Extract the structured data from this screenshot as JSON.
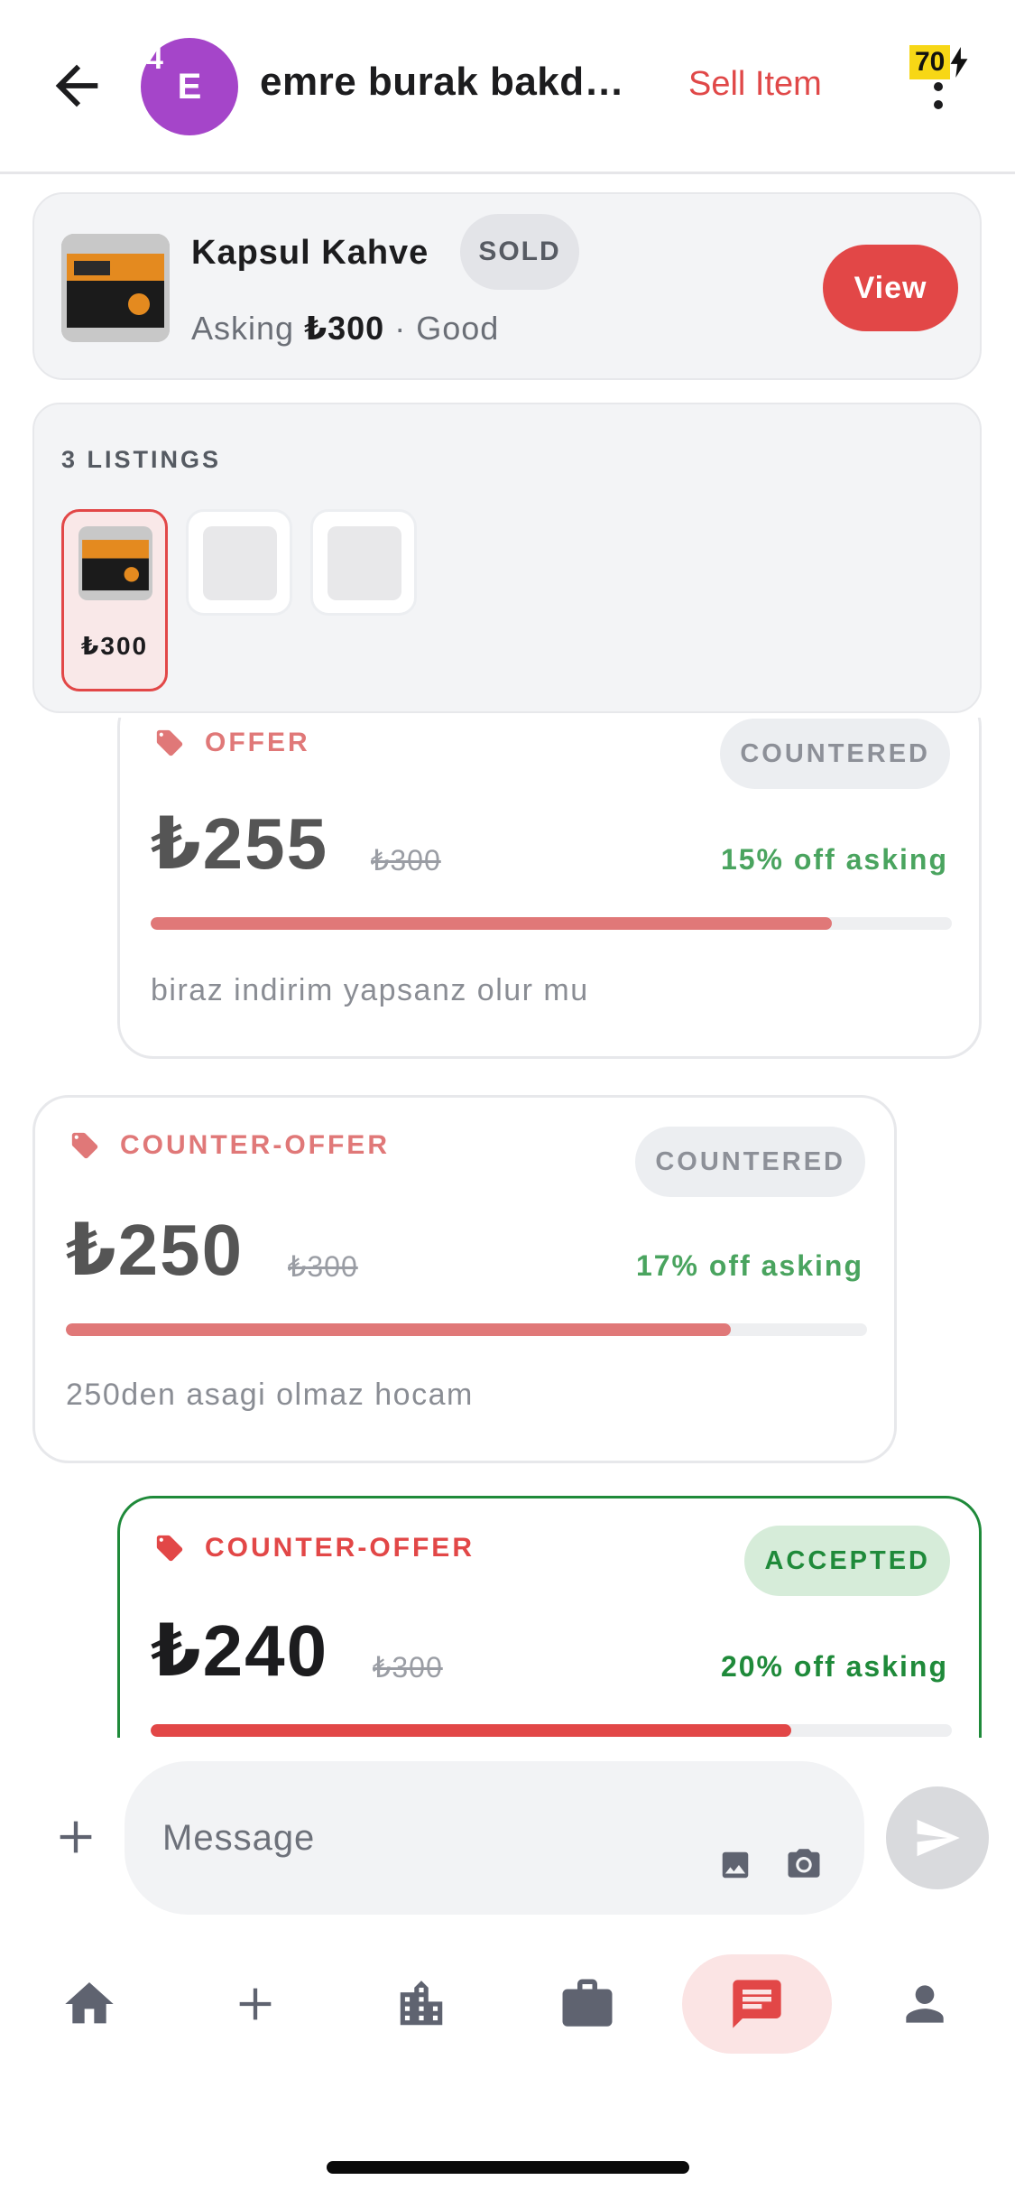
{
  "header": {
    "back_icon": "arrow-left-icon",
    "avatar_initial": "E",
    "avatar_badge": "4",
    "avatar_color": "#a545c9",
    "chat_name": "emre burak bakd…",
    "sell_item_label": "Sell Item",
    "credits": "70",
    "credits_icon": "bolt-icon",
    "menu_icon": "kebab-icon"
  },
  "item": {
    "title": "Kapsul Kahve",
    "status_badge": "SOLD",
    "asking_label": "Asking",
    "asking_price": "₺300",
    "meta_sep": " · ",
    "condition": "Good",
    "view_label": "View"
  },
  "listings": {
    "title": "3 LISTINGS",
    "items": [
      {
        "price": "₺300",
        "selected": true
      },
      {
        "price": "",
        "selected": false
      },
      {
        "price": "",
        "selected": false
      }
    ]
  },
  "offers": [
    {
      "type": "OFFER",
      "status": "COUNTERED",
      "amount": "₺255",
      "original": "₺300",
      "discount": "15% off asking",
      "progress": 0.85,
      "note": "biraz indirim yapsanz olur mu"
    },
    {
      "type": "COUNTER-OFFER",
      "status": "COUNTERED",
      "amount": "₺250",
      "original": "₺300",
      "discount": "17% off asking",
      "progress": 0.83,
      "note": "250den asagi olmaz hocam"
    },
    {
      "type": "COUNTER-OFFER",
      "status": "ACCEPTED",
      "amount": "₺240",
      "original": "₺300",
      "discount": "20% off asking",
      "progress": 0.8,
      "note": ""
    }
  ],
  "composer": {
    "placeholder": "Message",
    "attach_icon": "plus-icon",
    "image_icon": "image-icon",
    "camera_icon": "camera-icon",
    "send_icon": "send-icon"
  },
  "nav": {
    "items": [
      "home-icon",
      "plus-icon",
      "city-icon",
      "briefcase-icon",
      "chat-icon",
      "person-icon"
    ],
    "active": "chat-icon"
  },
  "colors": {
    "accent": "#e24747",
    "accepted": "#1f8a3a",
    "discount_green": "#4aa45f",
    "muted_red": "#e07878"
  }
}
